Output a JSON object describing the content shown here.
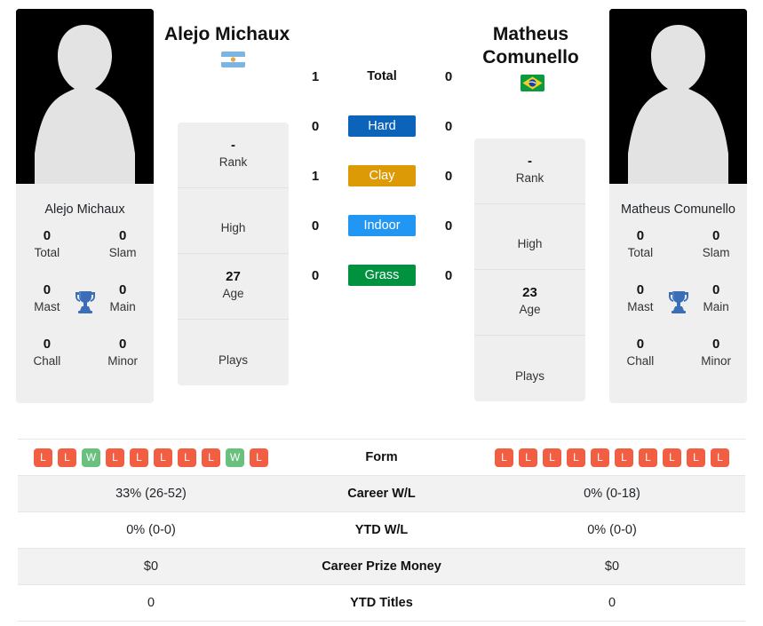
{
  "colors": {
    "hard": "#0b64ba",
    "clay": "#dd9a07",
    "indoor": "#2196f3",
    "grass": "#00923f",
    "win": "#6ac17e",
    "loss": "#f15e42",
    "card_bg": "#efefef",
    "row_shade": "#f2f2f2"
  },
  "players": {
    "left": {
      "headline_name": "Alejo Michaux",
      "photo_caption": "Alejo Michaux",
      "flag": "argentina-flag",
      "titles": [
        {
          "value": "0",
          "label": "Total"
        },
        {
          "value": "0",
          "label": "Slam"
        },
        {
          "value": "0",
          "label": "Mast"
        },
        {
          "value": "0",
          "label": "Main"
        },
        {
          "value": "0",
          "label": "Chall"
        },
        {
          "value": "0",
          "label": "Minor"
        }
      ],
      "info": [
        {
          "value": "-",
          "label": "Rank"
        },
        {
          "value": "",
          "label": "High"
        },
        {
          "value": "27",
          "label": "Age"
        },
        {
          "value": "",
          "label": "Plays"
        }
      ],
      "h2h": {
        "total": "1",
        "hard": "0",
        "clay": "1",
        "indoor": "0",
        "grass": "0"
      },
      "form": [
        "L",
        "L",
        "W",
        "L",
        "L",
        "L",
        "L",
        "L",
        "W",
        "L"
      ],
      "career_wl": "33% (26-52)",
      "ytd_wl": "0% (0-0)",
      "career_prize_money": "$0",
      "ytd_titles": "0"
    },
    "right": {
      "headline_name": "Matheus Comunello",
      "photo_caption": "Matheus Comunello",
      "flag": "brazil-flag",
      "titles": [
        {
          "value": "0",
          "label": "Total"
        },
        {
          "value": "0",
          "label": "Slam"
        },
        {
          "value": "0",
          "label": "Mast"
        },
        {
          "value": "0",
          "label": "Main"
        },
        {
          "value": "0",
          "label": "Chall"
        },
        {
          "value": "0",
          "label": "Minor"
        }
      ],
      "info": [
        {
          "value": "-",
          "label": "Rank"
        },
        {
          "value": "",
          "label": "High"
        },
        {
          "value": "23",
          "label": "Age"
        },
        {
          "value": "",
          "label": "Plays"
        }
      ],
      "h2h": {
        "total": "0",
        "hard": "0",
        "clay": "0",
        "indoor": "0",
        "grass": "0"
      },
      "form": [
        "L",
        "L",
        "L",
        "L",
        "L",
        "L",
        "L",
        "L",
        "L",
        "L"
      ],
      "career_wl": "0% (0-18)",
      "ytd_wl": "0% (0-0)",
      "career_prize_money": "$0",
      "ytd_titles": "0"
    }
  },
  "surfaces": [
    {
      "key": "total",
      "label": "Total",
      "style": "plain"
    },
    {
      "key": "hard",
      "label": "Hard",
      "style": "hard"
    },
    {
      "key": "clay",
      "label": "Clay",
      "style": "clay"
    },
    {
      "key": "indoor",
      "label": "Indoor",
      "style": "indoor"
    },
    {
      "key": "grass",
      "label": "Grass",
      "style": "grass"
    }
  ],
  "table": {
    "rows": [
      {
        "label": "Form",
        "key": "form"
      },
      {
        "label": "Career W/L",
        "key": "career_wl"
      },
      {
        "label": "YTD W/L",
        "key": "ytd_wl"
      },
      {
        "label": "Career Prize Money",
        "key": "career_prize_money"
      },
      {
        "label": "YTD Titles",
        "key": "ytd_titles"
      }
    ]
  }
}
